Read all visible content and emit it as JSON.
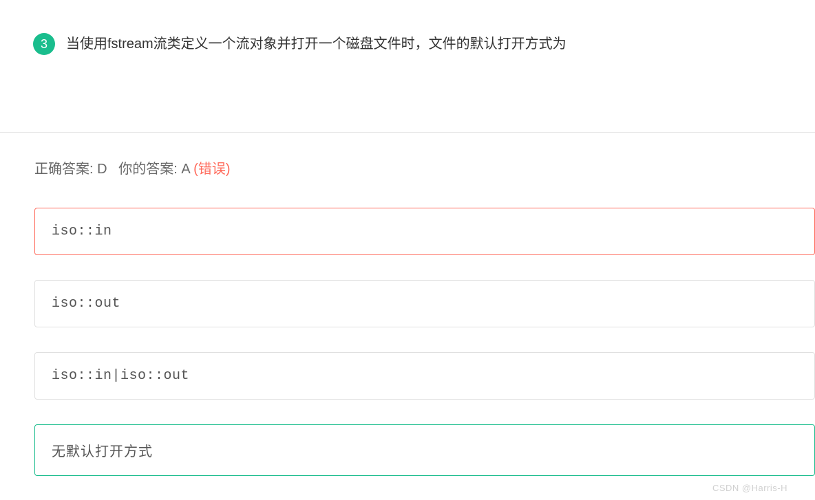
{
  "question": {
    "number": "3",
    "text": "当使用fstream流类定义一个流对象并打开一个磁盘文件时，文件的默认打开方式为"
  },
  "answer_info": {
    "correct_label": "正确答案: ",
    "correct_value": "D",
    "your_label": "你的答案: ",
    "your_value": "A ",
    "wrong_text": "(错误)"
  },
  "options": {
    "a": "iso::in",
    "b": "iso::out",
    "c": "iso::in|iso::out",
    "d": "无默认打开方式"
  },
  "watermark": "CSDN @Harris-H"
}
